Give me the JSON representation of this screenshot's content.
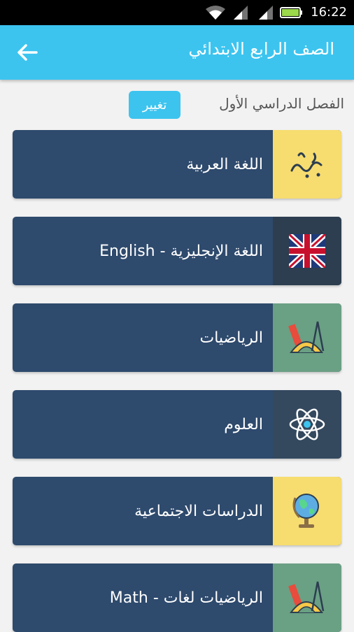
{
  "status_bar": {
    "time": "16:22"
  },
  "app_bar": {
    "title": "الصف الرابع الابتدائي"
  },
  "term": {
    "label": "الفصل الدراسي الأول",
    "change_button": "تغيير"
  },
  "subjects": [
    {
      "label": "اللغة العربية",
      "icon": "arabic-calligraphy-icon",
      "color": "#f7dc6f"
    },
    {
      "label": "اللغة الإنجليزية - English",
      "icon": "uk-flag-icon",
      "color": "#2c3e50"
    },
    {
      "label": "الرياضيات",
      "icon": "geometry-tools-icon",
      "color": "#6aa084"
    },
    {
      "label": "العلوم",
      "icon": "atom-icon",
      "color": "#34495e"
    },
    {
      "label": "الدراسات الاجتماعية",
      "icon": "globe-icon",
      "color": "#f7dc6f"
    },
    {
      "label": "الرياضيات لغات - Math",
      "icon": "geometry-tools-icon",
      "color": "#6aa084"
    }
  ]
}
